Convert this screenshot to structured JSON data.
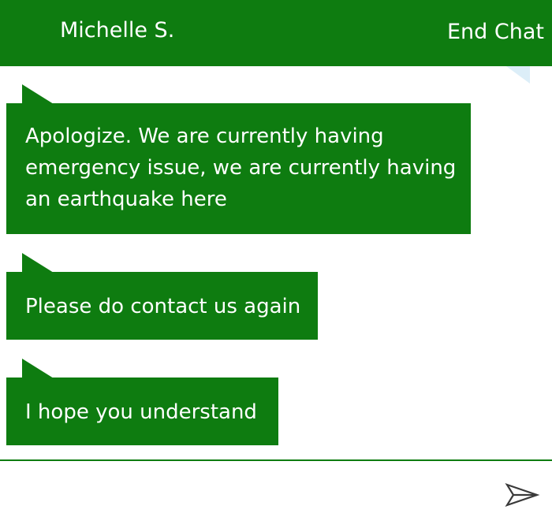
{
  "header": {
    "agent_name": "Michelle S.",
    "end_chat_label": "End Chat"
  },
  "messages": [
    {
      "lines": [
        "Apologize. We are currently having",
        "emergency issue, we are currently having",
        "an earthquake here"
      ]
    },
    {
      "lines": [
        "Please do contact us again"
      ]
    },
    {
      "lines": [
        "I hope you understand"
      ]
    }
  ],
  "composer": {
    "value": "",
    "send_icon": "send-icon"
  },
  "colors": {
    "accent": "#0e7c10",
    "background": "#ffffff",
    "corner_tab": "#dceef8"
  }
}
